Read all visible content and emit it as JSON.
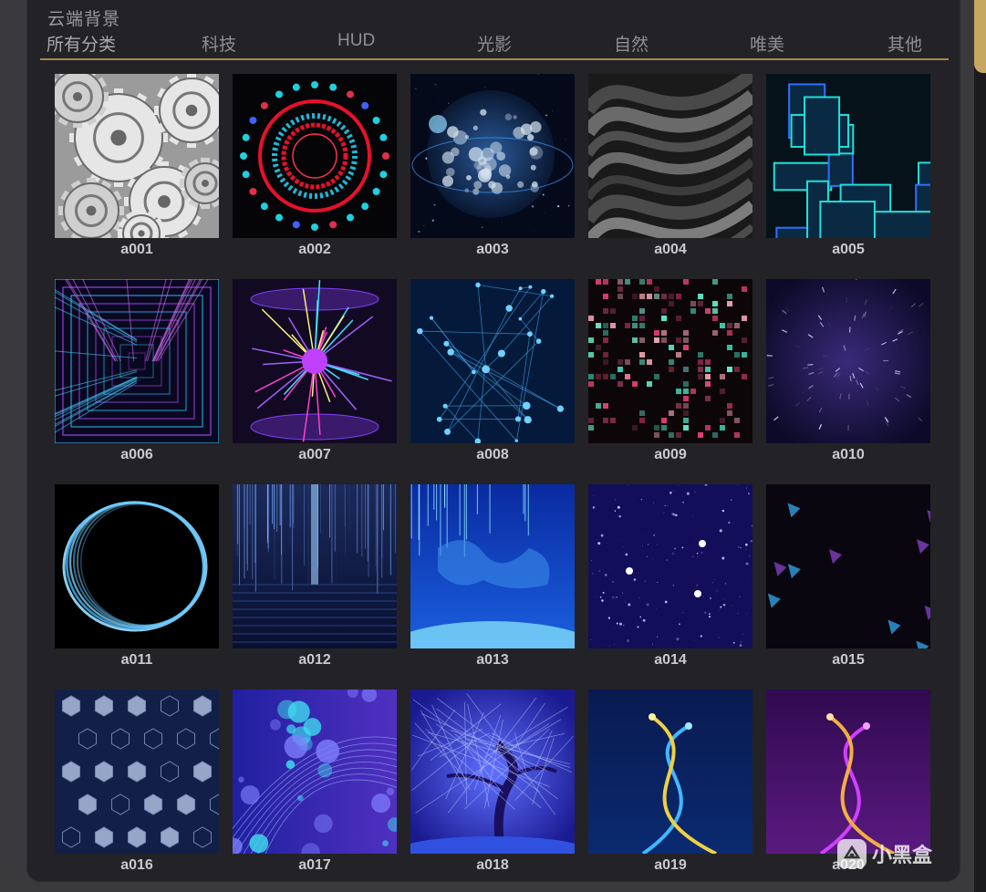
{
  "panel": {
    "title": "云端背景"
  },
  "tabs": [
    "所有分类",
    "科技",
    "HUD",
    "光影",
    "自然",
    "唯美",
    "其他"
  ],
  "active_tab": "所有分类",
  "accent_color": "#a38a4d",
  "items": [
    {
      "label": "a001",
      "theme": "gears"
    },
    {
      "label": "a002",
      "theme": "neon-rings"
    },
    {
      "label": "a003",
      "theme": "earth"
    },
    {
      "label": "a004",
      "theme": "silk"
    },
    {
      "label": "a005",
      "theme": "circuit"
    },
    {
      "label": "a006",
      "theme": "light-tunnel"
    },
    {
      "label": "a007",
      "theme": "energy-core"
    },
    {
      "label": "a008",
      "theme": "network"
    },
    {
      "label": "a009",
      "theme": "pixels"
    },
    {
      "label": "a010",
      "theme": "starfield"
    },
    {
      "label": "a011",
      "theme": "light-ring"
    },
    {
      "label": "a012",
      "theme": "data-rain"
    },
    {
      "label": "a013",
      "theme": "world-map"
    },
    {
      "label": "a014",
      "theme": "stars"
    },
    {
      "label": "a015",
      "theme": "dark-shards"
    },
    {
      "label": "a016",
      "theme": "hexagons"
    },
    {
      "label": "a017",
      "theme": "bokeh"
    },
    {
      "label": "a018",
      "theme": "tree"
    },
    {
      "label": "a019",
      "theme": "gold-blue-streaks"
    },
    {
      "label": "a020",
      "theme": "purple-streaks"
    }
  ],
  "watermark": {
    "text": "小黑盒",
    "icon": "xiaoheihe-logo-icon"
  }
}
